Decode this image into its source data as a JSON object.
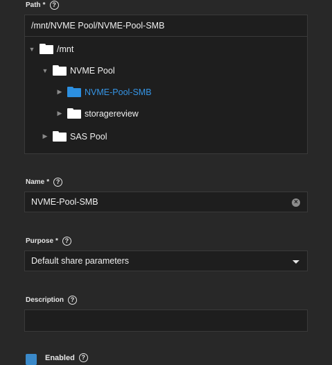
{
  "path": {
    "label": "Path",
    "required": "*",
    "value": "/mnt/NVME Pool/NVME-Pool-SMB",
    "tree": {
      "mnt": "/mnt",
      "nvme_pool": "NVME Pool",
      "nvme_pool_smb": "NVME-Pool-SMB",
      "storagereview": "storagereview",
      "sas_pool": "SAS Pool"
    }
  },
  "name": {
    "label": "Name",
    "required": "*",
    "value": "NVME-Pool-SMB"
  },
  "purpose": {
    "label": "Purpose",
    "required": "*",
    "value": "Default share parameters"
  },
  "description": {
    "label": "Description",
    "value": ""
  },
  "enabled": {
    "label": "Enabled",
    "checked": true
  },
  "icons": {
    "help": "?",
    "clear": "×",
    "expanded": "▼",
    "collapsed": "▶"
  },
  "colors": {
    "accent": "#3595e6",
    "background": "#282828",
    "field": "#1e1e1e"
  }
}
